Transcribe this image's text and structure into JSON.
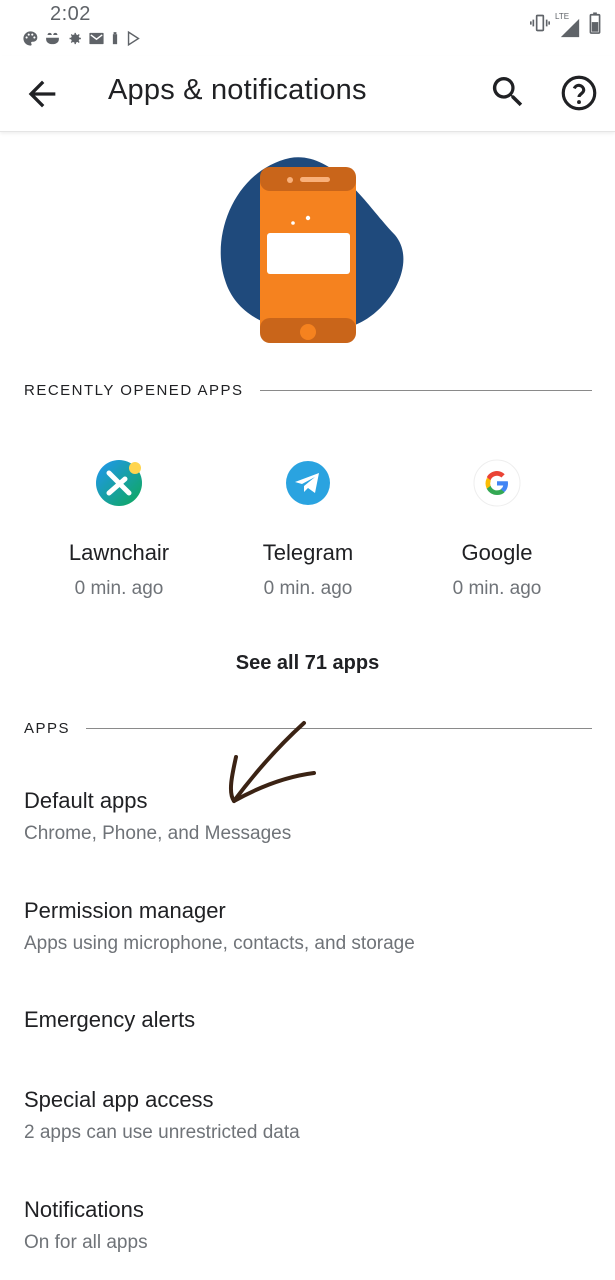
{
  "status_bar": {
    "time": "2:02",
    "left_icons": [
      "palette-icon",
      "cloud-icon",
      "settings-gear-icon",
      "gmail-icon",
      "battery-saver-icon",
      "play-store-icon"
    ],
    "right_icons": [
      "vibrate-icon",
      "lte-signal-icon",
      "battery-icon"
    ],
    "network_label": "LTE"
  },
  "app_bar": {
    "title": "Apps & notifications"
  },
  "recent": {
    "header": "RECENTLY OPENED APPS",
    "apps": [
      {
        "name": "Lawnchair",
        "time": "0 min. ago"
      },
      {
        "name": "Telegram",
        "time": "0 min. ago"
      },
      {
        "name": "Google",
        "time": "0 min. ago"
      }
    ],
    "see_all": "See all 71 apps"
  },
  "apps_section": {
    "header": "APPS",
    "items": [
      {
        "title": "Default apps",
        "summary": "Chrome, Phone, and Messages"
      },
      {
        "title": "Permission manager",
        "summary": "Apps using microphone, contacts, and storage"
      },
      {
        "title": "Emergency alerts",
        "summary": ""
      },
      {
        "title": "Special app access",
        "summary": "2 apps can use unrestricted data"
      },
      {
        "title": "Notifications",
        "summary": "On for all apps"
      }
    ]
  },
  "colors": {
    "hero_blob": "#1f4a7c",
    "hero_phone": "#f5821f",
    "hero_phone_dark": "#c9651a",
    "annotation": "#3b2314",
    "telegram": "#2aa3e0"
  }
}
